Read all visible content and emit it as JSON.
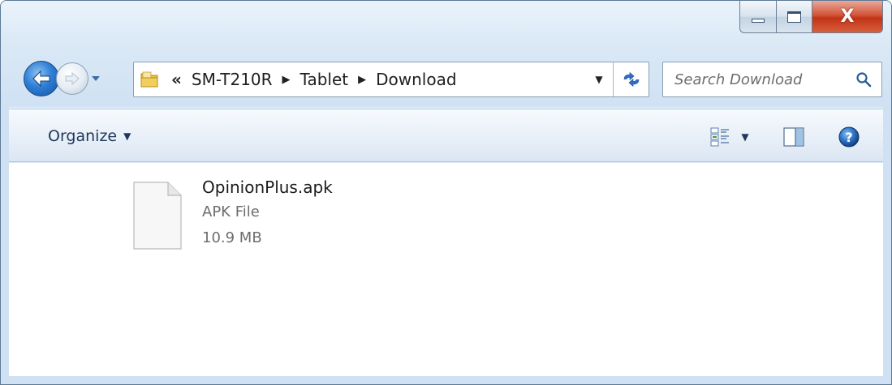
{
  "window": {
    "caption_buttons": {
      "minimize_icon": "minimize-icon",
      "maximize_icon": "maximize-icon",
      "close_glyph": "X"
    }
  },
  "navigation": {
    "back_icon": "back-arrow-icon",
    "forward_icon": "forward-arrow-icon",
    "history_icon": "chevron-down-icon"
  },
  "address_bar": {
    "overflow": "«",
    "breadcrumbs": [
      "SM-T210R",
      "Tablet",
      "Download"
    ],
    "separator": "▶",
    "dropdown_glyph": "▼",
    "refresh_icon": "refresh-icon"
  },
  "search": {
    "placeholder": "Search Download",
    "icon": "search-icon"
  },
  "toolbar": {
    "organize_label": "Organize",
    "organize_arrow": "▼",
    "view_arrow": "▼",
    "view_icon": "change-view-icon",
    "preview_pane_icon": "preview-pane-icon",
    "help_icon": "help-icon"
  },
  "files": [
    {
      "name": "OpinionPlus.apk",
      "type": "APK File",
      "size": "10.9 MB",
      "icon": "generic-file-icon"
    }
  ]
}
